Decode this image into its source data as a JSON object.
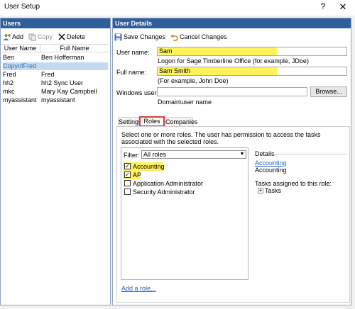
{
  "window": {
    "title": "User Setup",
    "help_glyph": "?",
    "close_glyph": "✕"
  },
  "users_panel": {
    "header": "Users",
    "toolbar": {
      "add": "Add",
      "copy": "Copy",
      "delete": "Delete"
    },
    "columns": [
      "User Name",
      "Full Name"
    ],
    "rows": [
      {
        "user": "Ben",
        "full": "Ben Hofferman"
      },
      {
        "user": "CopyofFred",
        "full": ""
      },
      {
        "user": "Fred",
        "full": "Fred"
      },
      {
        "user": "hh2",
        "full": "hh2 Sync User"
      },
      {
        "user": "mkc",
        "full": "Mary Kay Campbell"
      },
      {
        "user": "myassistant",
        "full": "myassistant"
      }
    ]
  },
  "details_panel": {
    "header": "User Details",
    "toolbar": {
      "save": "Save Changes",
      "cancel": "Cancel Changes"
    },
    "user_name_label": "User name:",
    "user_name_value": "Sam",
    "user_name_hint": "Logon for Sage Timberline Office (for example, JDoe)",
    "full_name_label": "Full name:",
    "full_name_value": "Sam Smith",
    "full_name_hint": "(For example, John Doe)",
    "windows_user_label": "Windows user:",
    "windows_user_value": "",
    "browse_button": "Browse...",
    "windows_user_hint": "Domain\\user name",
    "tabs": [
      "Settings",
      "Roles",
      "Companies"
    ],
    "roles_instruction": "Select one or more roles. The user has permission to access the tasks associated with the selected roles.",
    "filter_label": "Filter:",
    "filter_value": "All roles",
    "roles": [
      {
        "name": "Accounting",
        "checked": true
      },
      {
        "name": "AP",
        "checked": true
      },
      {
        "name": "Application Administrator",
        "checked": false
      },
      {
        "name": "Security Administrator",
        "checked": false
      }
    ],
    "add_role_link": "Add a role...",
    "details_section": {
      "title": "Details",
      "role_link": "Accounting",
      "role_desc": "Accounting",
      "tasks_label": "Tasks assigned to this role:",
      "tasks_node": "Tasks"
    }
  },
  "colors": {
    "header_bg": "#2f5e98",
    "highlight": "#fff35a",
    "tab_outline": "#e23a3a",
    "link": "#1c5fbd"
  }
}
